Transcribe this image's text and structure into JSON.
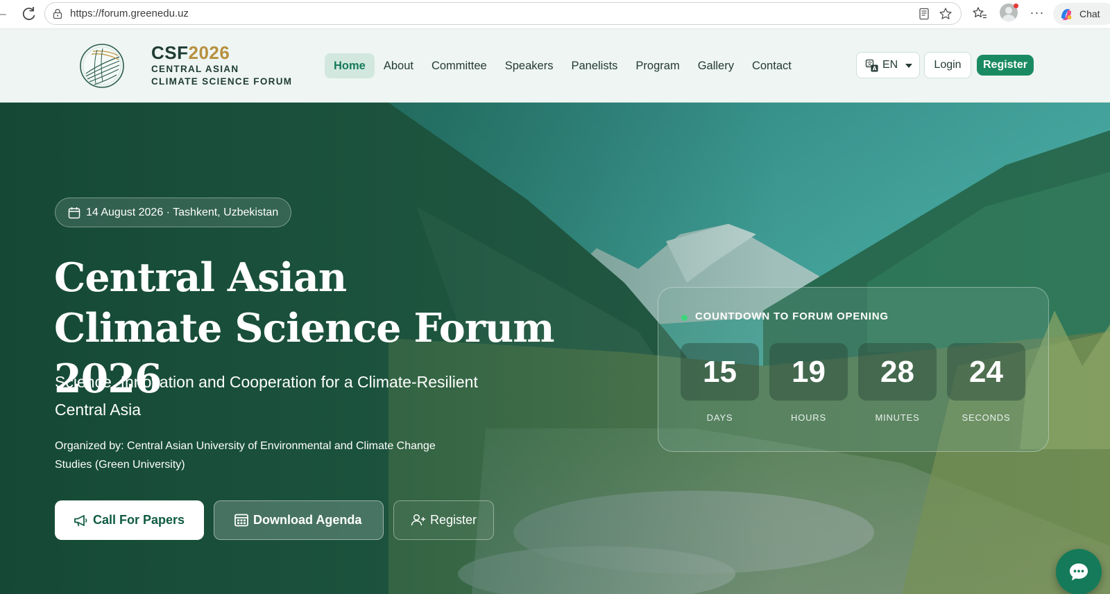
{
  "browser": {
    "url": "https://forum.greenedu.uz",
    "chat_label": "Chat"
  },
  "header": {
    "brand_code": "CSF",
    "brand_year": "2026",
    "brand_line1": "CENTRAL ASIAN",
    "brand_line2": "CLIMATE SCIENCE FORUM",
    "nav": [
      {
        "label": "Home",
        "active": true
      },
      {
        "label": "About"
      },
      {
        "label": "Committee"
      },
      {
        "label": "Speakers"
      },
      {
        "label": "Panelists"
      },
      {
        "label": "Program"
      },
      {
        "label": "Gallery"
      },
      {
        "label": "Contact"
      }
    ],
    "language": "EN",
    "login_label": "Login",
    "register_label": "Register"
  },
  "hero": {
    "date_location": "14 August 2026 · Tashkent, Uzbekistan",
    "title_line1": "Central Asian",
    "title_line2": "Climate Science Forum 2026",
    "subtitle": "Science, Innovation and Cooperation for a Climate-Resilient Central Asia",
    "organizer": "Organized by: Central Asian University of Environmental and Climate Change Studies (Green University)",
    "buttons": {
      "papers": "Call For Papers",
      "agenda": "Download Agenda",
      "register": "Register"
    }
  },
  "countdown": {
    "title": "COUNTDOWN TO FORUM OPENING",
    "units": [
      {
        "value": "15",
        "label": "DAYS"
      },
      {
        "value": "19",
        "label": "HOURS"
      },
      {
        "value": "28",
        "label": "MINUTES"
      },
      {
        "value": "24",
        "label": "SECONDS"
      }
    ]
  },
  "colors": {
    "brand_green": "#1a8a62",
    "brand_gold": "#b7903f",
    "header_bg": "#eef5f2",
    "countdown_dot": "#3fd47c"
  }
}
